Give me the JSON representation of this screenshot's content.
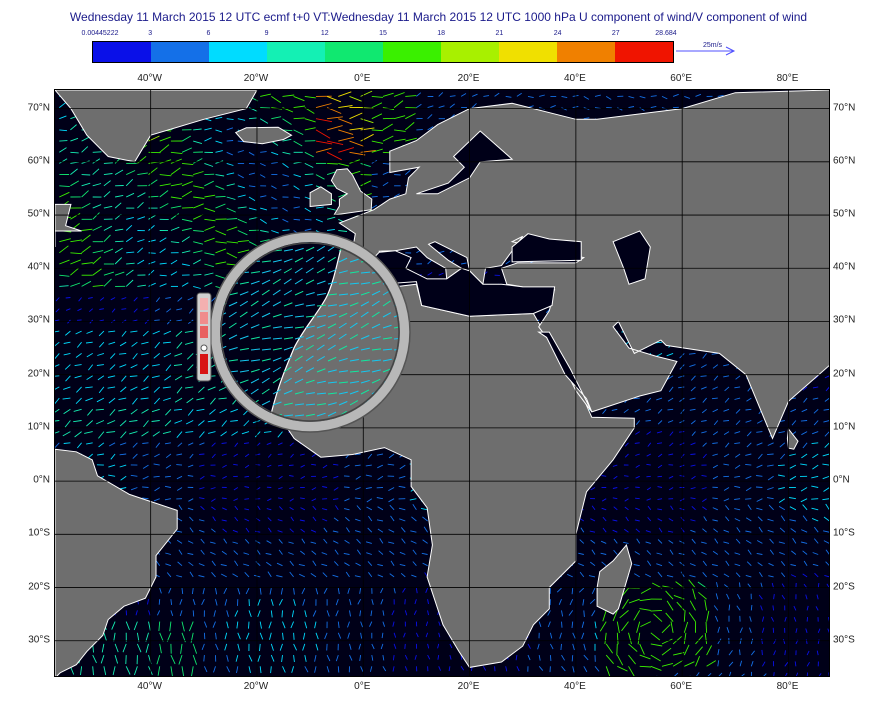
{
  "title": "Wednesday 11 March 2015 12 UTC ecmf t+0 VT:Wednesday 11 March 2015 12 UTC 1000 hPa  U component of wind/V component of wind",
  "legend": {
    "bins": [
      {
        "color": "#0a10e8"
      },
      {
        "color": "#1470e8"
      },
      {
        "color": "#00dcff"
      },
      {
        "color": "#14f0b4"
      },
      {
        "color": "#10e870"
      },
      {
        "color": "#3af000"
      },
      {
        "color": "#a8f000"
      },
      {
        "color": "#f0e000"
      },
      {
        "color": "#f08000"
      },
      {
        "color": "#f01400"
      }
    ],
    "ticks": [
      "0.00445222",
      "3",
      "6",
      "9",
      "12",
      "15",
      "18",
      "21",
      "24",
      "27",
      "28.684"
    ],
    "vector_key_label": "25m/s"
  },
  "map": {
    "lon_labels": [
      "40°W",
      "20°W",
      "0°E",
      "20°E",
      "40°E",
      "60°E",
      "80°E"
    ],
    "lat_labels": [
      "70°N",
      "60°N",
      "50°N",
      "40°N",
      "30°N",
      "20°N",
      "10°N",
      "0°N",
      "10°S",
      "20°S",
      "30°S"
    ],
    "ocean_color": "#000018",
    "land_color": "#6e6e6e",
    "coast_color": "#ffffff",
    "grid_color": "#000000",
    "field_name": "1000 hPa wind vectors coloured by speed (m/s)"
  },
  "magnifier": {
    "icon": "magnifier-lens-icon",
    "bar_icon": "zoom-level-bar-icon"
  }
}
